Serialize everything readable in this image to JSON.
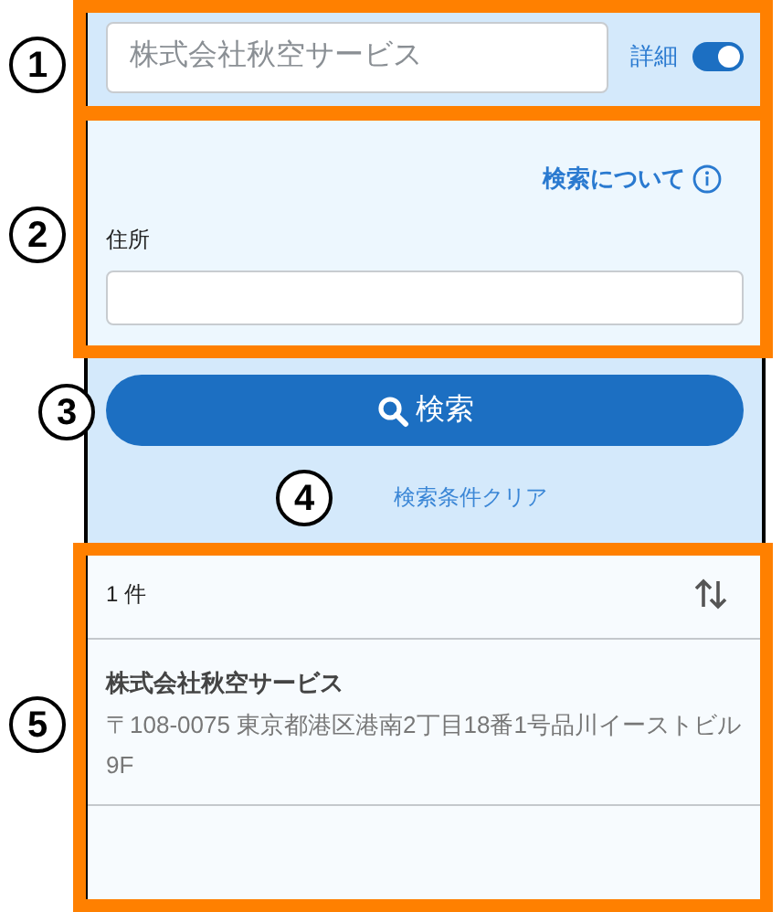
{
  "search": {
    "name_field": {
      "placeholder": "株式会社秋空サービス"
    },
    "details_toggle": {
      "label": "詳細",
      "on": true
    }
  },
  "advanced": {
    "help_link": "検索について",
    "address_label": "住所"
  },
  "actions": {
    "search_button": "検索",
    "clear_link": "検索条件クリア"
  },
  "results": {
    "count": "1 件",
    "items": [
      {
        "name": "株式会社秋空サービス",
        "address": "〒108-0075 東京都港区港南2丁目18番1号品川イーストビル9F"
      }
    ]
  },
  "annotations": [
    {
      "label": "1"
    },
    {
      "label": "2"
    },
    {
      "label": "3"
    },
    {
      "label": "4"
    },
    {
      "label": "5"
    }
  ]
}
